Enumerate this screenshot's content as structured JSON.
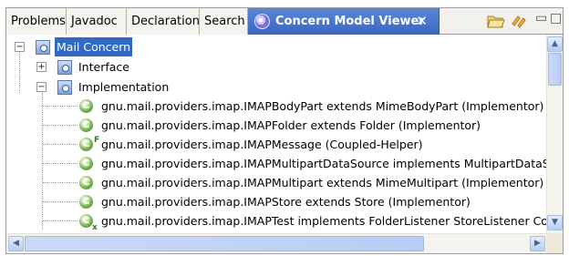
{
  "tabs": [
    {
      "label": "Problems",
      "active": false
    },
    {
      "label": "Javadoc",
      "active": false
    },
    {
      "label": "Declaration",
      "active": false
    },
    {
      "label": "Search",
      "active": false
    },
    {
      "label": "Concern Model Viewer",
      "active": true
    }
  ],
  "toolbar": {
    "close_glyph": "✕",
    "icons": [
      "open-folder-icon",
      "sync-icon"
    ],
    "minimize_glyph": "▭",
    "maximize_glyph": "□"
  },
  "tree": {
    "root": {
      "label": "Mail Concern",
      "selected": true
    },
    "nodes": [
      {
        "label": "Interface",
        "expanded": false
      },
      {
        "label": "Implementation",
        "expanded": true
      }
    ],
    "items": [
      {
        "label": "gnu.mail.providers.imap.IMAPBodyPart extends MimeBodyPart (Implementor)",
        "badge": ""
      },
      {
        "label": "gnu.mail.providers.imap.IMAPFolder extends Folder (Implementor)",
        "badge": ""
      },
      {
        "label": "gnu.mail.providers.imap.IMAPMessage (Coupled-Helper)",
        "badge": "F"
      },
      {
        "label": "gnu.mail.providers.imap.IMAPMultipartDataSource implements MultipartDataSc",
        "badge": ""
      },
      {
        "label": "gnu.mail.providers.imap.IMAPMultipart extends MimeMultipart (Implementor)",
        "badge": ""
      },
      {
        "label": "gnu.mail.providers.imap.IMAPStore extends Store (Implementor)",
        "badge": ""
      },
      {
        "label": "gnu.mail.providers.imap.IMAPTest implements FolderListener StoreListener Co",
        "badge": "x"
      }
    ],
    "expander_collapsed": "+",
    "expander_expanded": "−",
    "class_icon_letter": "C"
  },
  "scrollbars": {
    "up_arrow": "▲",
    "down_arrow": "▼",
    "left_arrow": "◀",
    "right_arrow": "▶"
  },
  "colors": {
    "active_tab": "#3a67bf",
    "selection": "#316ac5",
    "class_icon": "#5a9a36"
  }
}
